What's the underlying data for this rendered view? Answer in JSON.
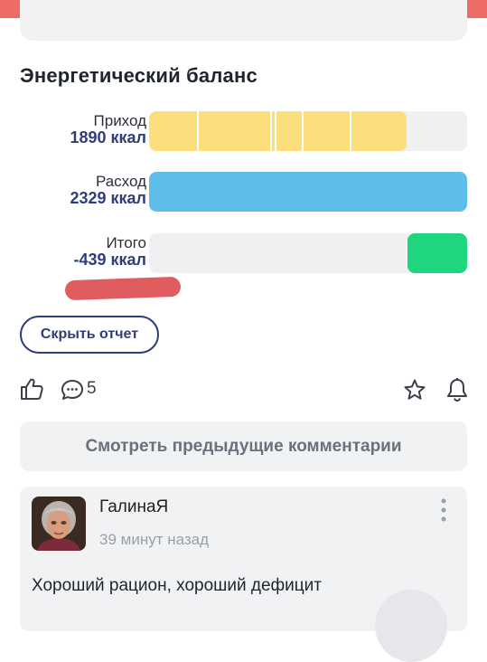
{
  "section_title": "Энергетический баланс",
  "balance": {
    "income": {
      "label": "Приход",
      "value": "1890 ккал",
      "fill_fraction": 0.811,
      "color": "#fcdf7c"
    },
    "expense": {
      "label": "Расход",
      "value": "2329 ккал",
      "fill_fraction": 1.0,
      "color": "#5fbde9"
    },
    "total": {
      "label": "Итого",
      "value": "-439 ккал",
      "fill_fraction": 0.188,
      "color": "#1fd67e"
    }
  },
  "hide_report_label": "Скрыть отчет",
  "actions": {
    "comment_count": "5"
  },
  "prev_comments_label": "Смотреть предыдущие комментарии",
  "comment": {
    "author": "ГалинаЯ",
    "time": "39 минут назад",
    "text": "Хороший рацион, хороший дефицит"
  }
}
